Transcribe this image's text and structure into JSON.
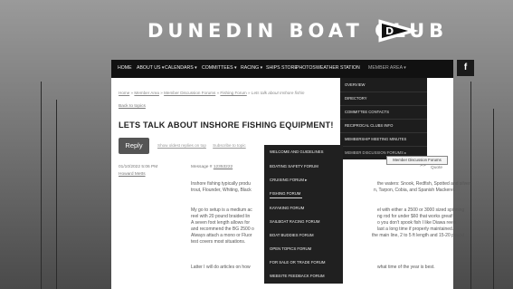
{
  "site": {
    "title": "DUNEDIN BOAT CLUB"
  },
  "nav": {
    "items": [
      {
        "label": "HOME"
      },
      {
        "label": "ABOUT US ▾"
      },
      {
        "label": "CALENDARS ▾"
      },
      {
        "label": "COMMITTEES ▾"
      },
      {
        "label": "RACING ▾"
      },
      {
        "label": "SHIPS STORE"
      },
      {
        "label": "PHOTOS"
      },
      {
        "label": "WEATHER STATION"
      },
      {
        "label": "MEMBER AREA ▾"
      }
    ],
    "social": "f"
  },
  "breadcrumb": {
    "items": [
      "Home",
      "Member Area",
      "Member Discussion Forums",
      "Fishing Forum",
      "Lets talk about Inshore fishin"
    ],
    "separator": "»"
  },
  "back_link": "Back to topics",
  "topic": {
    "title": "LETS TALK ABOUT INSHORE FISHING EQUIPMENT!",
    "reply_label": "Reply",
    "sort_links": [
      "Show oldest replies on top",
      "Subscribe to topic"
    ]
  },
  "message": {
    "date": "01/10/2022 5:06 PM",
    "author": "Howard Metts",
    "number_label": "Message #",
    "number": "12353222",
    "pager": ">>",
    "quote": "Quote",
    "paragraphs": [
      [
        "Inshore fishing typically produ",
        "the waters:  Snook, Redfish, Spotted and silver",
        "trout, Flounder, Whiting, Black",
        "n, Tarpon, Cobia, and Spanish Mackerel."
      ],
      [
        "My go to setup is a medium ac",
        "el with either a 2500 or 3000 sized spinning",
        "reel with 20 pound braided lin",
        "ng rod for under $60 that works great!",
        "A seven foot length allows for",
        "o you don't spook fish I like Diawa reels",
        "and recommend the BG 2500 o",
        "last a long time if properly maintained.",
        "Always attach a mono or Fluor",
        "the main line, 2 to 5 ft length and 15-20 pound",
        "test covers most situations."
      ],
      [
        "Latter I will do articles on how",
        "what time of the year is best."
      ]
    ]
  },
  "member_area_menu": {
    "items": [
      "OVERVIEW",
      "DIRECTORY",
      "COMMITTEE CONTACTS",
      "RECIPROCAL CLUBS INFO",
      "MEMBERSHIP MEETING MINUTES",
      "MEMBER DISCUSSION FORUMS ▸"
    ]
  },
  "forums_menu": {
    "items": [
      "WELCOME AND GUIDELINES",
      "BOATING SAFETY FORUM",
      "CRUISING FORUM ▸",
      "FISHING FORUM",
      "KAYAKING FORUM",
      "SAILBOAT RACING FORUM",
      "BOAT BUDDIES FORUM",
      "OPEN TOPICS FORUM",
      "FOR SALE OR TRADE FORUM",
      "WEBSITE FEEDBACK FORUM"
    ]
  },
  "tooltip": "Member Discussion Forums"
}
